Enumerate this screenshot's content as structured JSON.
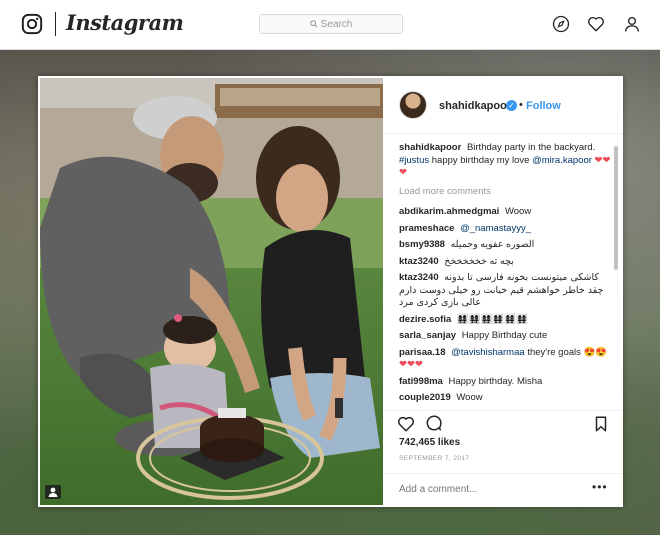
{
  "app": {
    "wordmark": "Instagram",
    "search_placeholder": "Search",
    "nav_icons": [
      "compass-icon",
      "heart-icon",
      "profile-icon"
    ]
  },
  "post": {
    "username": "shahidkapoor",
    "separator": "•",
    "follow_label": "Follow",
    "caption": {
      "user": "shahidkapoor",
      "text_before": "Birthday party in the backyard.",
      "hashtag": "#justus",
      "text_middle": "happy birthday my love",
      "mention": "@mira.kapoor",
      "emoji": "❤❤❤"
    },
    "load_more": "Load more comments",
    "comments": [
      {
        "user": "abdikarim.ahmedgmai",
        "text": "Woow"
      },
      {
        "user": "prameshace",
        "text": "@_namastayyy_",
        "is_link": true
      },
      {
        "user": "bsmy9388",
        "text": "الصوره عفويه وجميله"
      },
      {
        "user": "ktaz3240",
        "text": "بچه ته خخخخخخخ"
      },
      {
        "user": "ktaz3240",
        "text": "کاشکی میتونست بخونه فارسی تا بدونه چقد خاطر خواهشم قیم خیانت رو خیلی دوست دارم عالی بازی کردی مرد",
        "rtl": true
      },
      {
        "user": "dezire.sofia",
        "text": "👩‍👩‍👧‍👧👩‍👩‍👧‍👧👩‍👩‍👧‍👧👩‍👩‍👧‍👧👩‍👩‍👧‍👧👩‍👩‍👧‍👧"
      },
      {
        "user": "sarla_sanjay",
        "text": "Happy Birthday cute"
      },
      {
        "user": "parisaa.18",
        "text": "they're goals",
        "mention": "@tavishisharmaa",
        "emoji": "😍😍❤❤❤"
      },
      {
        "user": "fati998ma",
        "text": "Happy birthday. Misha"
      },
      {
        "user": "couple2019",
        "text": "Woow"
      }
    ],
    "likes": "742,465 likes",
    "date": "SEPTEMBER 7, 2017",
    "add_comment_placeholder": "Add a comment...",
    "more_label": "•••"
  },
  "colors": {
    "link": "#003569",
    "accent": "#3897f0",
    "heart": "#ed4956"
  }
}
